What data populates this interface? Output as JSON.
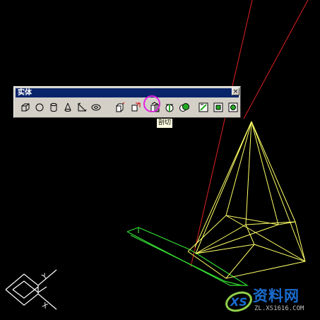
{
  "toolbar": {
    "title": "实体",
    "close_symbol": "×",
    "buttons": [
      {
        "name": "box",
        "icon": "box-icon"
      },
      {
        "name": "sphere",
        "icon": "sphere-icon"
      },
      {
        "name": "cylinder",
        "icon": "cylinder-icon"
      },
      {
        "name": "cone",
        "icon": "cone-icon"
      },
      {
        "name": "wedge",
        "icon": "wedge-icon"
      },
      {
        "name": "torus",
        "icon": "torus-icon"
      },
      {
        "name": "extrude",
        "icon": "extrude-icon"
      },
      {
        "name": "revolve",
        "icon": "revolve-icon"
      },
      {
        "name": "slice",
        "icon": "slice-icon"
      },
      {
        "name": "section",
        "icon": "section-icon"
      },
      {
        "name": "interference",
        "icon": "interference-icon"
      },
      {
        "name": "setup-drawing",
        "icon": "setup-drawing-icon"
      },
      {
        "name": "setup-view",
        "icon": "setup-view-icon"
      },
      {
        "name": "setup-profile",
        "icon": "setup-profile-icon"
      }
    ],
    "active_button": "slice"
  },
  "tooltip": {
    "text": "剖切"
  },
  "ucs": {
    "x_label": "X",
    "y_label": "Y"
  },
  "watermark": {
    "brand": "资料网",
    "url": "ZL.XS1616.COM",
    "logo_text": "XS"
  },
  "colors": {
    "background": "#000000",
    "wire_yellow": "#ffff66",
    "wire_green": "#33dd33",
    "cut_line_red": "#e02020",
    "ucs_white": "#ffffff",
    "highlight": "#e020e0"
  }
}
